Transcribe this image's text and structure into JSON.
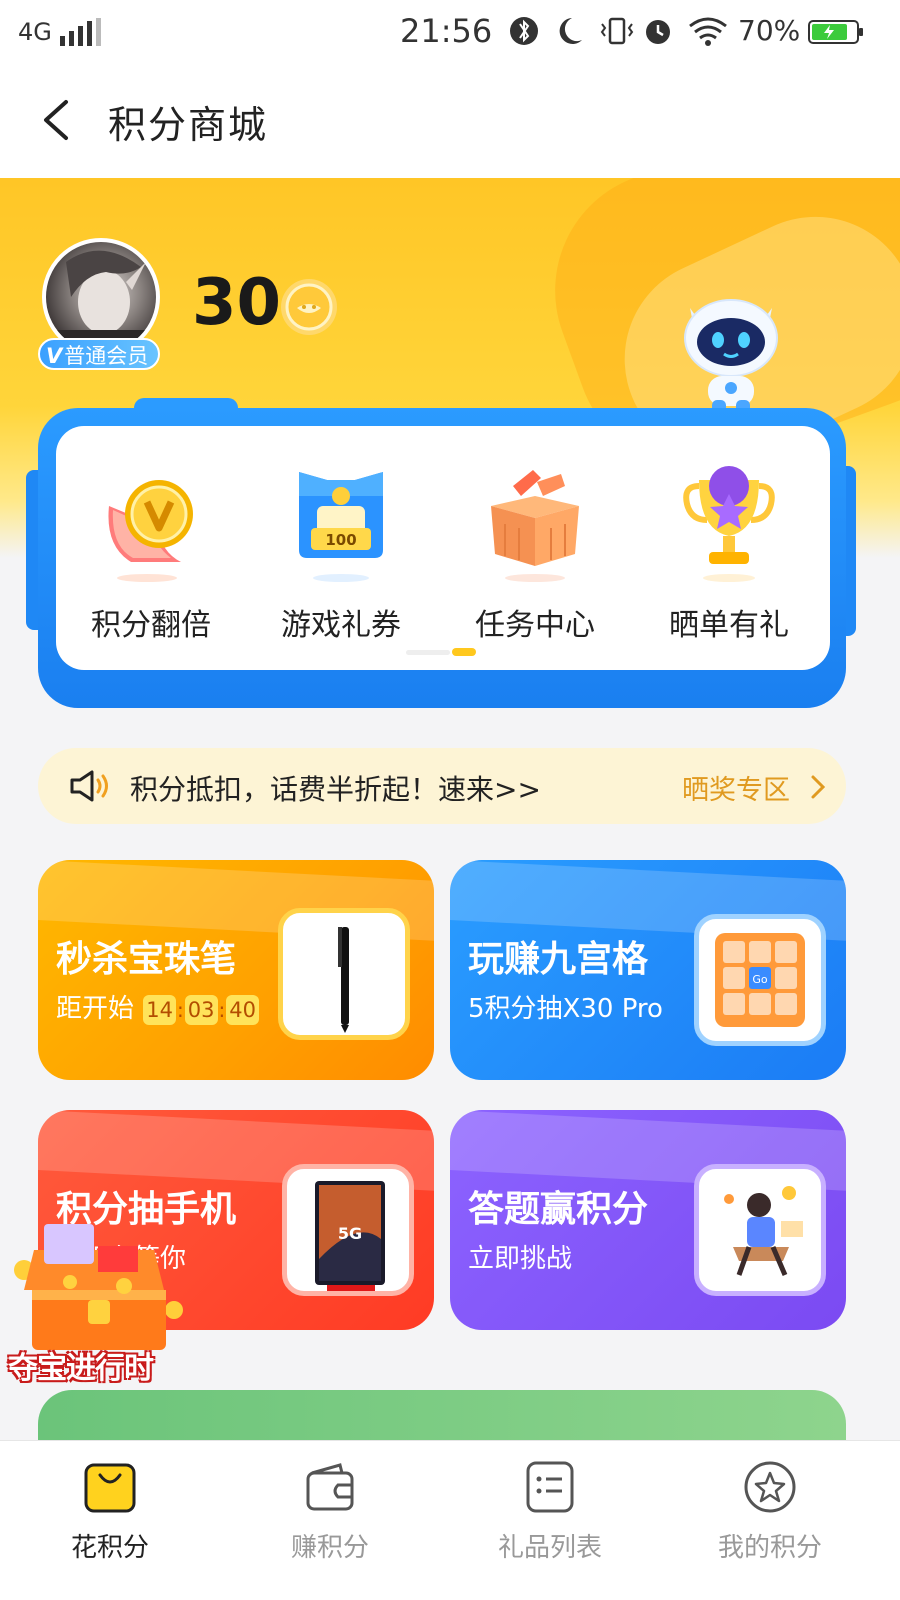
{
  "status_bar": {
    "network": "4G",
    "time": "21:56",
    "battery": "70%"
  },
  "header": {
    "title": "积分商城"
  },
  "profile": {
    "badge_v": "V",
    "badge_text": "普通会员",
    "points": "30"
  },
  "quick_entries": [
    {
      "label": "积分翻倍",
      "icon": "coin-double-icon"
    },
    {
      "label": "游戏礼券",
      "icon": "game-coupon-icon"
    },
    {
      "label": "任务中心",
      "icon": "task-box-icon"
    },
    {
      "label": "晒单有礼",
      "icon": "trophy-icon"
    }
  ],
  "pager": {
    "current": 2,
    "total": 2
  },
  "notice": {
    "text": "积分抵扣，话费半折起！速来>>",
    "link": "晒奖专区"
  },
  "promos": {
    "flash": {
      "title": "秒杀宝珠笔",
      "countdown_label": "距开始",
      "h": "14",
      "m": "03",
      "s": "40"
    },
    "grid": {
      "title": "玩赚九宫格",
      "subtitle": "5积分抽X30 Pro"
    },
    "phone": {
      "title": "积分抽手机",
      "subtitle": "手机在等你"
    },
    "quiz": {
      "title": "答题赢积分",
      "subtitle": "立即挑战"
    }
  },
  "floating": {
    "label": "夺宝进行时"
  },
  "bottom_nav": [
    {
      "label": "花积分",
      "icon": "shopping-bag-icon",
      "active": true
    },
    {
      "label": "赚积分",
      "icon": "wallet-icon",
      "active": false
    },
    {
      "label": "礼品列表",
      "icon": "list-icon",
      "active": false
    },
    {
      "label": "我的积分",
      "icon": "star-badge-icon",
      "active": false
    }
  ],
  "colors": {
    "brand_yellow": "#ffc626",
    "brand_blue": "#2b9bff",
    "link_orange": "#e09a20"
  }
}
